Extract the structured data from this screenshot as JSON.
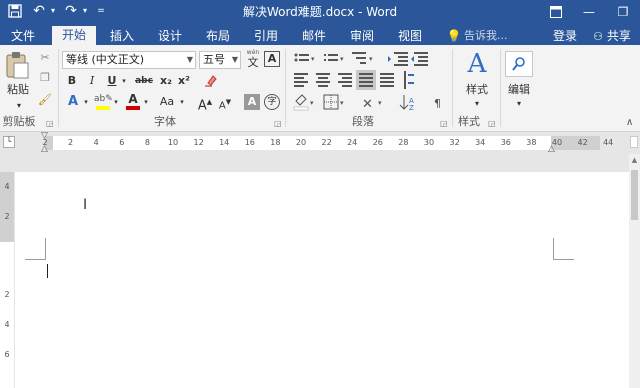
{
  "window": {
    "title": "解决Word难题.docx - Word",
    "accent": "#2b579a",
    "qat": {
      "save_icon": "save-icon",
      "undo_icon": "undo-icon",
      "redo_icon": "redo-icon",
      "customize_icon": "customize-qat-icon"
    },
    "controls": {
      "ribbon_display_icon": "ribbon-display-options-icon",
      "minimize": "—",
      "restore": "❐"
    }
  },
  "tabs": [
    {
      "label": "文件"
    },
    {
      "label": "开始",
      "active": true
    },
    {
      "label": "插入"
    },
    {
      "label": "设计"
    },
    {
      "label": "布局"
    },
    {
      "label": "引用"
    },
    {
      "label": "邮件"
    },
    {
      "label": "审阅"
    },
    {
      "label": "视图"
    }
  ],
  "tell_me": "告诉我...",
  "signin": "登录",
  "share": "共享",
  "clipboard": {
    "paste": "粘贴",
    "label": "剪贴板"
  },
  "font": {
    "name": "等线 (中文正文)",
    "size": "五号",
    "wen": "wén",
    "wen_char": "文",
    "box_a": "A",
    "bold": "B",
    "italic": "I",
    "underline": "U",
    "strike": "abc",
    "sub": "x₂",
    "sup": "x²",
    "case": "Aa",
    "grow": "A",
    "shrink": "A",
    "shade_a": "A",
    "enclose": "字",
    "label": "字体",
    "highlight_color": "#ffff00",
    "font_color": "#d00000"
  },
  "paragraph": {
    "label": "段落"
  },
  "styles": {
    "glyph": "A",
    "button": "样式",
    "label": "样式"
  },
  "editing": {
    "button": "编辑"
  },
  "ruler": {
    "numbers": [
      "2",
      "2",
      "4",
      "6",
      "8",
      "10",
      "12",
      "14",
      "16",
      "18",
      "20",
      "22",
      "24",
      "26",
      "28",
      "30",
      "32",
      "34",
      "36",
      "38",
      "40",
      "42",
      "44"
    ],
    "vnumbers": [
      "4",
      "2",
      "2",
      "4",
      "6"
    ]
  }
}
